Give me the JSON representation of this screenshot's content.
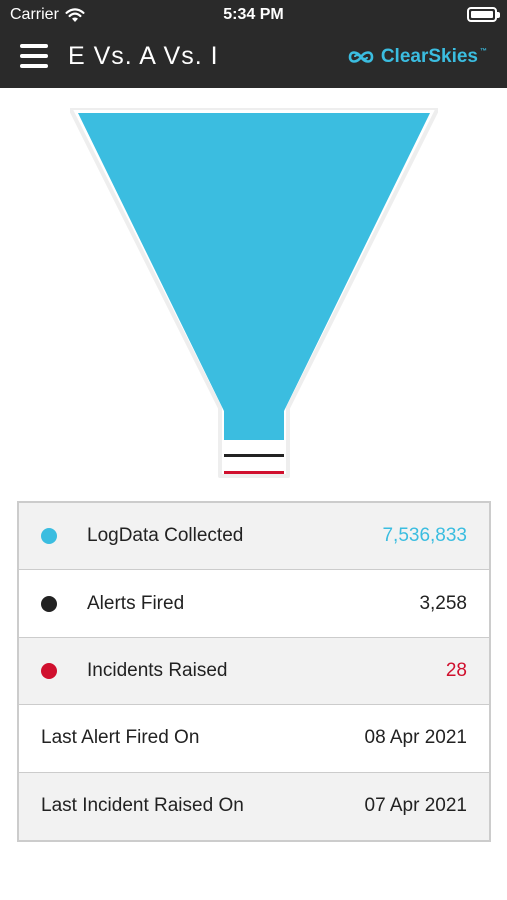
{
  "status_bar": {
    "carrier": "Carrier",
    "time": "5:34 PM"
  },
  "header": {
    "title": "E Vs. A Vs. I",
    "brand": "ClearSkies",
    "brand_tm": "™",
    "menu_icon": "hamburger-menu-icon"
  },
  "colors": {
    "header_bg": "#2a2a2a",
    "logdata": "#3bbde0",
    "alerts": "#222222",
    "incidents": "#d0102e"
  },
  "funnel_levels": [
    {
      "name": "LogData Collected",
      "color": "#3bbde0"
    },
    {
      "name": "Alerts Fired",
      "color": "#222222"
    },
    {
      "name": "Incidents Raised",
      "color": "#d0102e"
    }
  ],
  "stats": {
    "logdata": {
      "label": "LogData Collected",
      "value": "7,536,833"
    },
    "alerts": {
      "label": "Alerts Fired",
      "value": "3,258"
    },
    "incidents": {
      "label": "Incidents Raised",
      "value": "28"
    },
    "last_alert": {
      "label": "Last Alert Fired On",
      "value": "08 Apr 2021"
    },
    "last_incident": {
      "label": "Last Incident Raised On",
      "value": "07 Apr 2021"
    }
  }
}
